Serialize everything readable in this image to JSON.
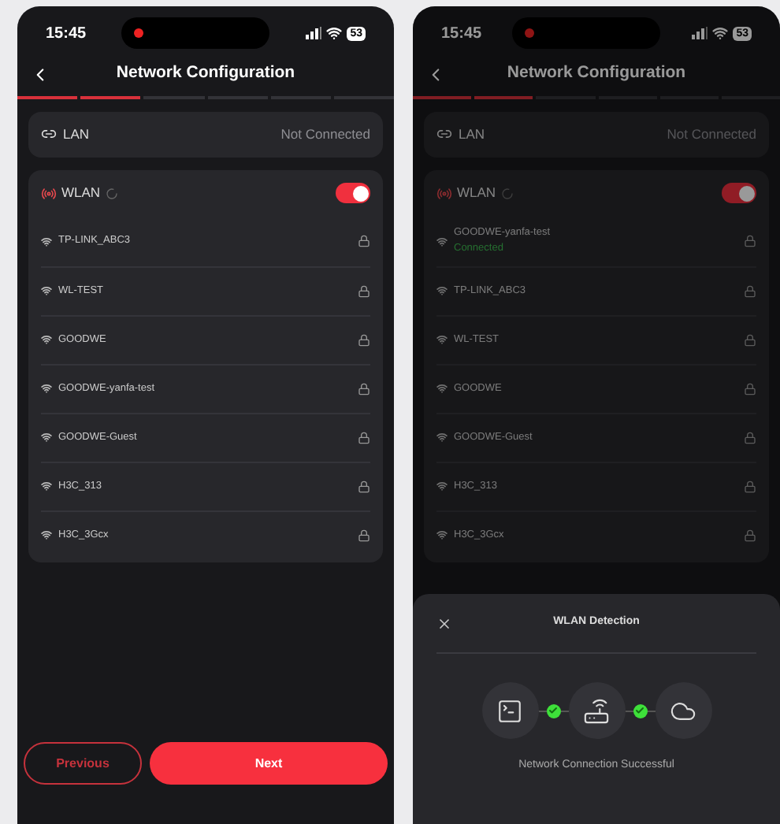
{
  "screens": [
    {
      "status_bar": {
        "time": "15:45",
        "battery": "53"
      },
      "title": "Network Configuration",
      "steps": [
        {
          "done": true
        },
        {
          "done": true
        },
        {
          "done": false
        },
        {
          "done": false
        },
        {
          "done": false
        },
        {
          "done": false
        }
      ],
      "lan": {
        "label": "LAN",
        "status": "Not Connected"
      },
      "wlan": {
        "label": "WLAN",
        "on": true,
        "networks": [
          {
            "name": "TP-LINK_ABC3"
          },
          {
            "name": "WL-TEST"
          },
          {
            "name": "GOODWE"
          },
          {
            "name": "GOODWE-yanfa-test"
          },
          {
            "name": "GOODWE-Guest"
          },
          {
            "name": "H3C_313"
          },
          {
            "name": "H3C_3Gcx"
          }
        ]
      },
      "buttons": {
        "previous": "Previous",
        "next": "Next"
      }
    },
    {
      "status_bar": {
        "time": "15:45",
        "battery": "53"
      },
      "title": "Network Configuration",
      "steps": [
        {
          "done": true
        },
        {
          "done": true
        },
        {
          "done": false
        },
        {
          "done": false
        },
        {
          "done": false
        },
        {
          "done": false
        }
      ],
      "lan": {
        "label": "LAN",
        "status": "Not Connected"
      },
      "wlan": {
        "label": "WLAN",
        "on": true,
        "networks": [
          {
            "name": "GOODWE-yanfa-test",
            "status": "Connected"
          },
          {
            "name": "TP-LINK_ABC3"
          },
          {
            "name": "WL-TEST"
          },
          {
            "name": "GOODWE"
          },
          {
            "name": "GOODWE-Guest"
          },
          {
            "name": "H3C_313"
          },
          {
            "name": "H3C_3Gcx"
          }
        ]
      },
      "dialog": {
        "title": "WLAN Detection",
        "links": [
          {
            "ok": true
          },
          {
            "ok": true
          }
        ],
        "message": "Network Connection Successful"
      }
    }
  ]
}
